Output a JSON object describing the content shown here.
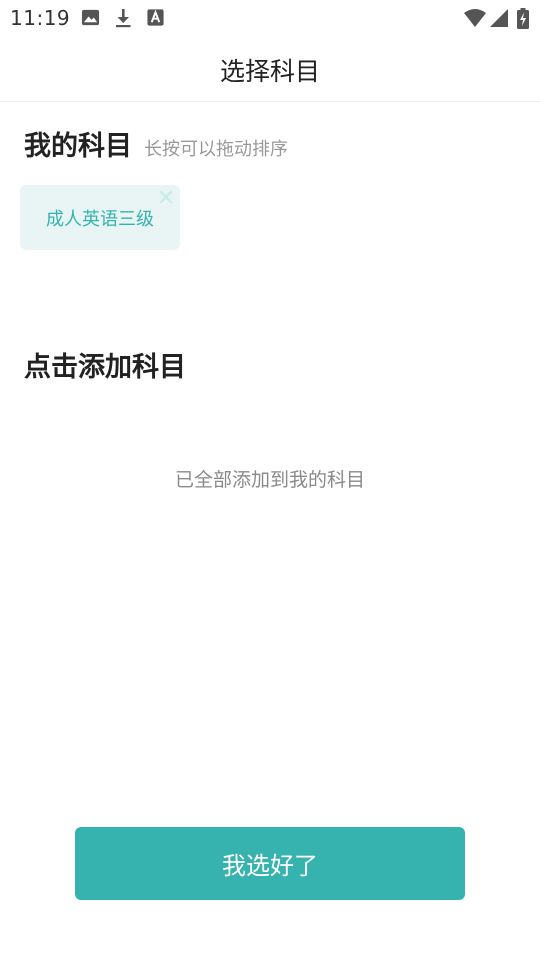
{
  "status_bar": {
    "time": "11:19",
    "left_icons": [
      "image-icon",
      "download-icon",
      "text-icon"
    ],
    "right_icons": [
      "wifi-icon",
      "signal-icon",
      "battery-charging-icon"
    ]
  },
  "header": {
    "title": "选择科目"
  },
  "my_subjects": {
    "title": "我的科目",
    "hint": "长按可以拖动排序",
    "items": [
      {
        "label": "成人英语三级",
        "remove_icon": "close-icon"
      }
    ]
  },
  "add_subjects": {
    "title": "点击添加科目",
    "empty_message": "已全部添加到我的科目"
  },
  "footer": {
    "confirm_label": "我选好了"
  },
  "colors": {
    "accent": "#36b3ae",
    "chip_background": "#e8f5f4",
    "chip_text": "#35b3ae",
    "muted_text": "#999999"
  }
}
